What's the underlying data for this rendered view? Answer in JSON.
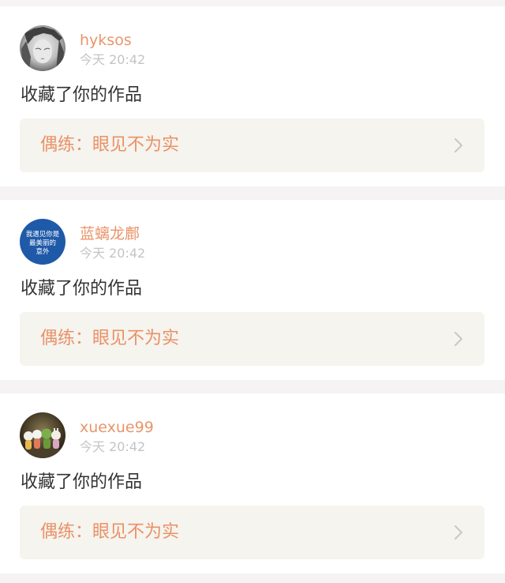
{
  "notifications": [
    {
      "avatar_icon": "grayscale-portrait-avatar",
      "username": "hyksos",
      "time": "今天 20:42",
      "action": "收藏了你的作品",
      "work_title": "偶练：眼见不为实"
    },
    {
      "avatar_icon": "blue-text-avatar",
      "avatar_text": [
        "我遇见你是",
        "最美丽的",
        "意外"
      ],
      "username": "蓝螭龙鄜",
      "time": "今天 20:42",
      "action": "收藏了你的作品",
      "work_title": "偶练：眼见不为实"
    },
    {
      "avatar_icon": "toy-figures-avatar",
      "username": "xuexue99",
      "time": "今天 20:42",
      "action": "收藏了你的作品",
      "work_title": "偶练：眼见不为实"
    }
  ],
  "colors": {
    "username": "#e9956a",
    "work_title": "#ea9067",
    "timestamp": "#c4c4c4",
    "link_background": "#f5f4ee",
    "page_background": "#f5f3f3"
  }
}
